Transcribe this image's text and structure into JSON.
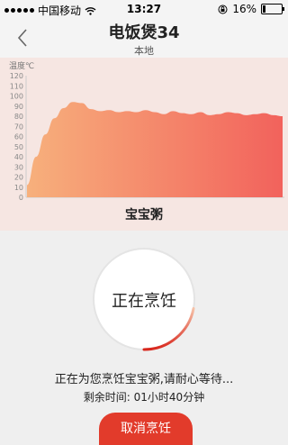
{
  "status_bar": {
    "carrier": "中国移动",
    "time": "13:27",
    "battery_percent": "16%",
    "battery_level": 0.16
  },
  "nav": {
    "title": "电饭煲34",
    "subtitle": "本地"
  },
  "chart_data": {
    "type": "area",
    "ylabel": "温度℃",
    "ylim": [
      0,
      120
    ],
    "yticks": [
      "0",
      "10",
      "20",
      "30",
      "40",
      "50",
      "60",
      "70",
      "80",
      "90",
      "100",
      "110",
      "120"
    ],
    "x": [
      0,
      2,
      4,
      6,
      8,
      10,
      12,
      14,
      16,
      18,
      20,
      22,
      24,
      26,
      28,
      30,
      32,
      34,
      36,
      38,
      40,
      42,
      44,
      46,
      48,
      50,
      52,
      54,
      56
    ],
    "values": [
      12,
      40,
      62,
      78,
      88,
      94,
      93,
      87,
      85,
      86,
      84,
      85,
      84,
      86,
      84,
      82,
      85,
      83,
      82,
      84,
      81,
      82,
      84,
      83,
      81,
      82,
      83,
      81,
      80
    ],
    "caption": "宝宝粥",
    "colors": {
      "start": "#f7b07c",
      "end": "#f2625c"
    }
  },
  "cooking": {
    "status": "正在烹饪",
    "progress": 0.22,
    "message": "正在为您烹饪宝宝粥,请耐心等待...",
    "remaining": "剩余时间:   01小时40分钟"
  },
  "actions": {
    "cancel_label": "取消烹饪"
  }
}
